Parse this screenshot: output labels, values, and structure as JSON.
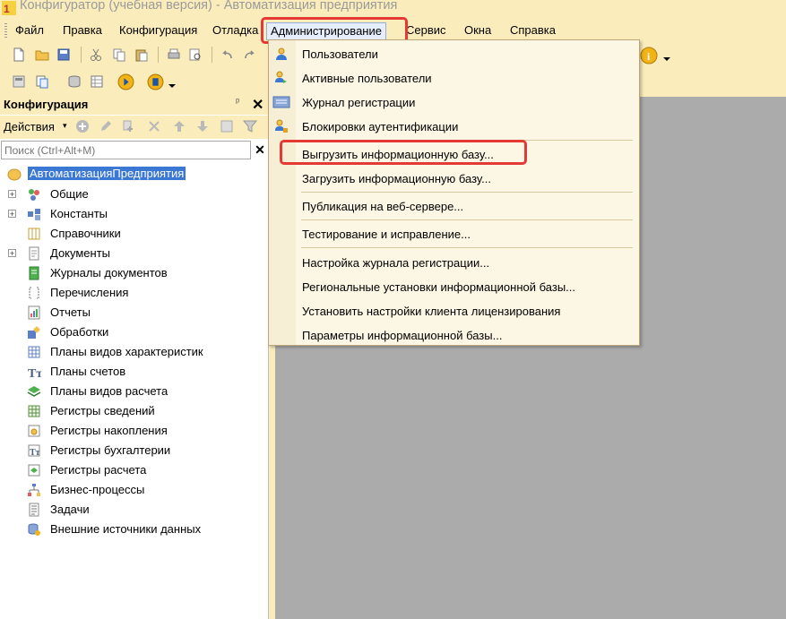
{
  "window": {
    "title": "Конфигуратор (учебная версия) - Автоматизация предприятия"
  },
  "menubar": {
    "items": [
      {
        "label": "Файл"
      },
      {
        "label": "Правка"
      },
      {
        "label": "Конфигурация"
      },
      {
        "label": "Отладка"
      },
      {
        "label": "Администрирование"
      },
      {
        "label": "Сервис"
      },
      {
        "label": "Окна"
      },
      {
        "label": "Справка"
      }
    ],
    "active": "Администрирование"
  },
  "admin_menu": {
    "items": [
      {
        "label": "Пользователи",
        "icon": "user-icon"
      },
      {
        "label": "Активные пользователи",
        "icon": "active-users-icon"
      },
      {
        "label": "Журнал регистрации",
        "icon": "event-log-icon"
      },
      {
        "label": "Блокировки аутентификации",
        "icon": "auth-lock-icon"
      },
      {
        "label": "Выгрузить информационную базу..."
      },
      {
        "label": "Загрузить информационную базу..."
      },
      {
        "label": "Публикация на веб-сервере..."
      },
      {
        "label": "Тестирование и исправление..."
      },
      {
        "label": "Настройка журнала регистрации..."
      },
      {
        "label": "Региональные установки информационной базы..."
      },
      {
        "label": "Установить настройки клиента лицензирования"
      },
      {
        "label": "Параметры информационной базы..."
      }
    ],
    "highlighted": "Выгрузить информационную базу..."
  },
  "config_panel": {
    "title": "Конфигурация",
    "actions_label": "Действия",
    "search": {
      "placeholder": "Поиск (Ctrl+Alt+M)",
      "value": ""
    },
    "root": "АвтоматизацияПредприятия",
    "nodes": [
      {
        "label": "Общие",
        "expandable": true,
        "icon": "common-icon"
      },
      {
        "label": "Константы",
        "expandable": true,
        "icon": "constants-icon"
      },
      {
        "label": "Справочники",
        "expandable": false,
        "icon": "catalogs-icon"
      },
      {
        "label": "Документы",
        "expandable": true,
        "icon": "documents-icon"
      },
      {
        "label": "Журналы документов",
        "expandable": false,
        "icon": "document-journals-icon"
      },
      {
        "label": "Перечисления",
        "expandable": false,
        "icon": "enums-icon"
      },
      {
        "label": "Отчеты",
        "expandable": false,
        "icon": "reports-icon"
      },
      {
        "label": "Обработки",
        "expandable": false,
        "icon": "data-processors-icon"
      },
      {
        "label": "Планы видов характеристик",
        "expandable": false,
        "icon": "chart-of-characteristic-types-icon"
      },
      {
        "label": "Планы счетов",
        "expandable": false,
        "icon": "chart-of-accounts-icon"
      },
      {
        "label": "Планы видов расчета",
        "expandable": false,
        "icon": "chart-of-calculation-types-icon"
      },
      {
        "label": "Регистры сведений",
        "expandable": false,
        "icon": "information-registers-icon"
      },
      {
        "label": "Регистры накопления",
        "expandable": false,
        "icon": "accumulation-registers-icon"
      },
      {
        "label": "Регистры бухгалтерии",
        "expandable": false,
        "icon": "accounting-registers-icon"
      },
      {
        "label": "Регистры расчета",
        "expandable": false,
        "icon": "calculation-registers-icon"
      },
      {
        "label": "Бизнес-процессы",
        "expandable": false,
        "icon": "business-processes-icon"
      },
      {
        "label": "Задачи",
        "expandable": false,
        "icon": "tasks-icon"
      },
      {
        "label": "Внешние источники данных",
        "expandable": false,
        "icon": "external-data-sources-icon"
      }
    ]
  },
  "colors": {
    "chrome": "#fbedbb",
    "menu_bg": "#fcf6e4",
    "selection": "#3b78d4",
    "highlight_box": "#e53935",
    "workspace": "#ababab"
  }
}
